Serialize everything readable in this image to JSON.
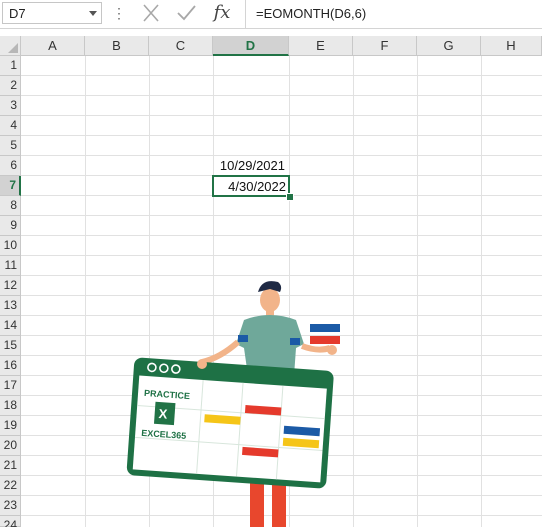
{
  "formula_bar": {
    "name_box": "D7",
    "formula": "=EOMONTH(D6,6)"
  },
  "icons": {
    "cancel": "close-icon",
    "enter": "check-icon",
    "fx": "fx"
  },
  "columns": [
    "A",
    "B",
    "C",
    "D",
    "E",
    "F",
    "G",
    "H"
  ],
  "active_column": "D",
  "rows": [
    "1",
    "2",
    "3",
    "4",
    "5",
    "6",
    "7",
    "8",
    "9",
    "10",
    "11",
    "12",
    "13",
    "14",
    "15",
    "16",
    "17",
    "18",
    "19",
    "20",
    "21",
    "22",
    "23",
    "24"
  ],
  "active_row": "7",
  "cells": {
    "D6": "10/29/2021",
    "D7": "4/30/2022"
  },
  "illustration": {
    "logo_line1": "PRACTICE",
    "logo_line2": "EXCEL365",
    "logo_x": "X",
    "colors": {
      "board_green": "#1e7145",
      "excel_green": "#217346",
      "red": "#e53a2c",
      "blue": "#1b5aa6",
      "yellow": "#f5c518",
      "shirt": "#6fa89a",
      "pants": "#e8472d"
    }
  }
}
